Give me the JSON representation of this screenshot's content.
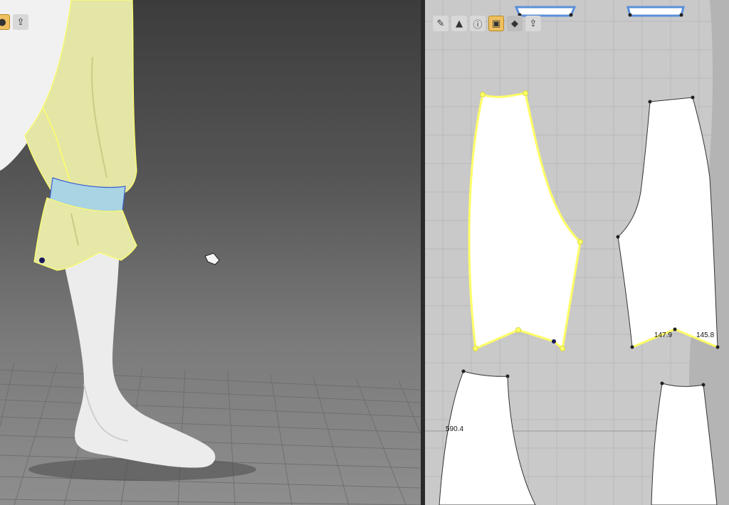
{
  "toolbar_3d": {
    "icons": [
      "avatar-display-icon",
      "export-icon"
    ]
  },
  "toolbar_2d": {
    "icons": [
      "segment-tool-icon",
      "transform-icon",
      "info-icon",
      "pattern-select-icon",
      "sewing-icon",
      "export-icon"
    ]
  },
  "measurements": {
    "hem_left": "147.9",
    "hem_right": "145.8",
    "side_length": "590.4"
  },
  "colors": {
    "selected_pattern": "#ffff66",
    "cuff_band": "#a9d4e4",
    "pattern_fill": "#ffffff",
    "canvas_2d": "#c9c9c9"
  }
}
